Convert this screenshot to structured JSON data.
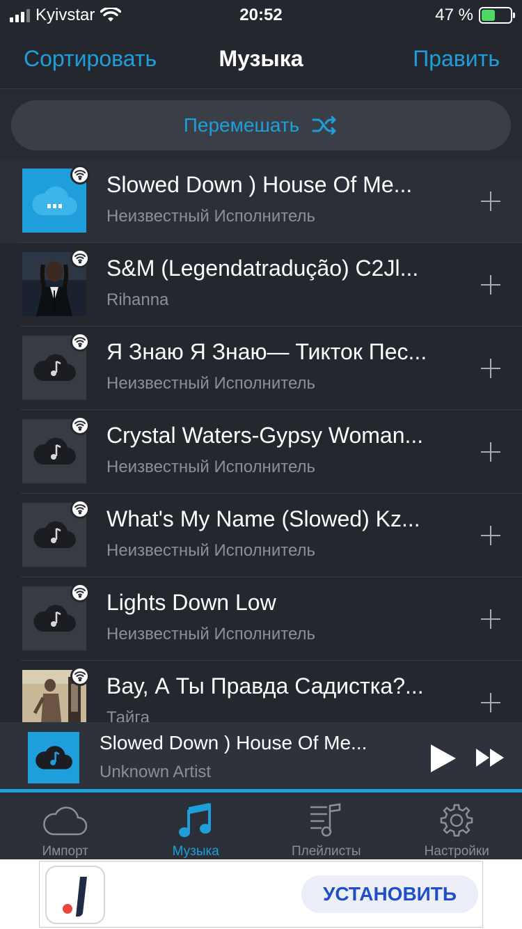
{
  "status_bar": {
    "carrier": "Kyivstar",
    "time": "20:52",
    "battery_percent": "47 %",
    "battery_level": 0.47
  },
  "nav": {
    "left": "Сортировать",
    "title": "Музыка",
    "right": "Править"
  },
  "shuffle": {
    "label": "Перемешать",
    "icon": "shuffle-icon"
  },
  "tracks": [
    {
      "title": "Slowed Down ) House Of Me...",
      "artist": "Неизвестный Исполнитель",
      "art": "cloud-loading-blue"
    },
    {
      "title": "S&M (Legendatradução) C2Jl...",
      "artist": "Rihanna",
      "art": "album-photo"
    },
    {
      "title": "Я Знаю Я Знаю— Тикток Пес...",
      "artist": "Неизвестный Исполнитель",
      "art": "cloud-music-icon"
    },
    {
      "title": "Crystal Waters-Gypsy Woman...",
      "artist": "Неизвестный Исполнитель",
      "art": "cloud-music-icon"
    },
    {
      "title": "What's My Name (Slowed) Kz...",
      "artist": "Неизвестный Исполнитель",
      "art": "cloud-music-icon"
    },
    {
      "title": "Lights Down Low",
      "artist": "Неизвестный Исполнитель",
      "art": "cloud-music-icon"
    },
    {
      "title": "Вау, А Ты Правда Садистка?...",
      "artist": "Тайга",
      "art": "album-photo"
    }
  ],
  "mini_player": {
    "title": "Slowed Down ) House Of Me...",
    "artist": "Unknown Artist",
    "progress": 1.0
  },
  "tabs": [
    {
      "label": "Импорт",
      "icon": "cloud-icon"
    },
    {
      "label": "Музыка",
      "icon": "music-notes-icon"
    },
    {
      "label": "Плейлисты",
      "icon": "playlist-icon"
    },
    {
      "label": "Настройки",
      "icon": "gear-icon"
    }
  ],
  "ad": {
    "button": "УСТАНОВИТЬ"
  },
  "colors": {
    "accent": "#1e9fdc",
    "background": "#24272e",
    "ad_button_text": "#1e4fc9"
  }
}
